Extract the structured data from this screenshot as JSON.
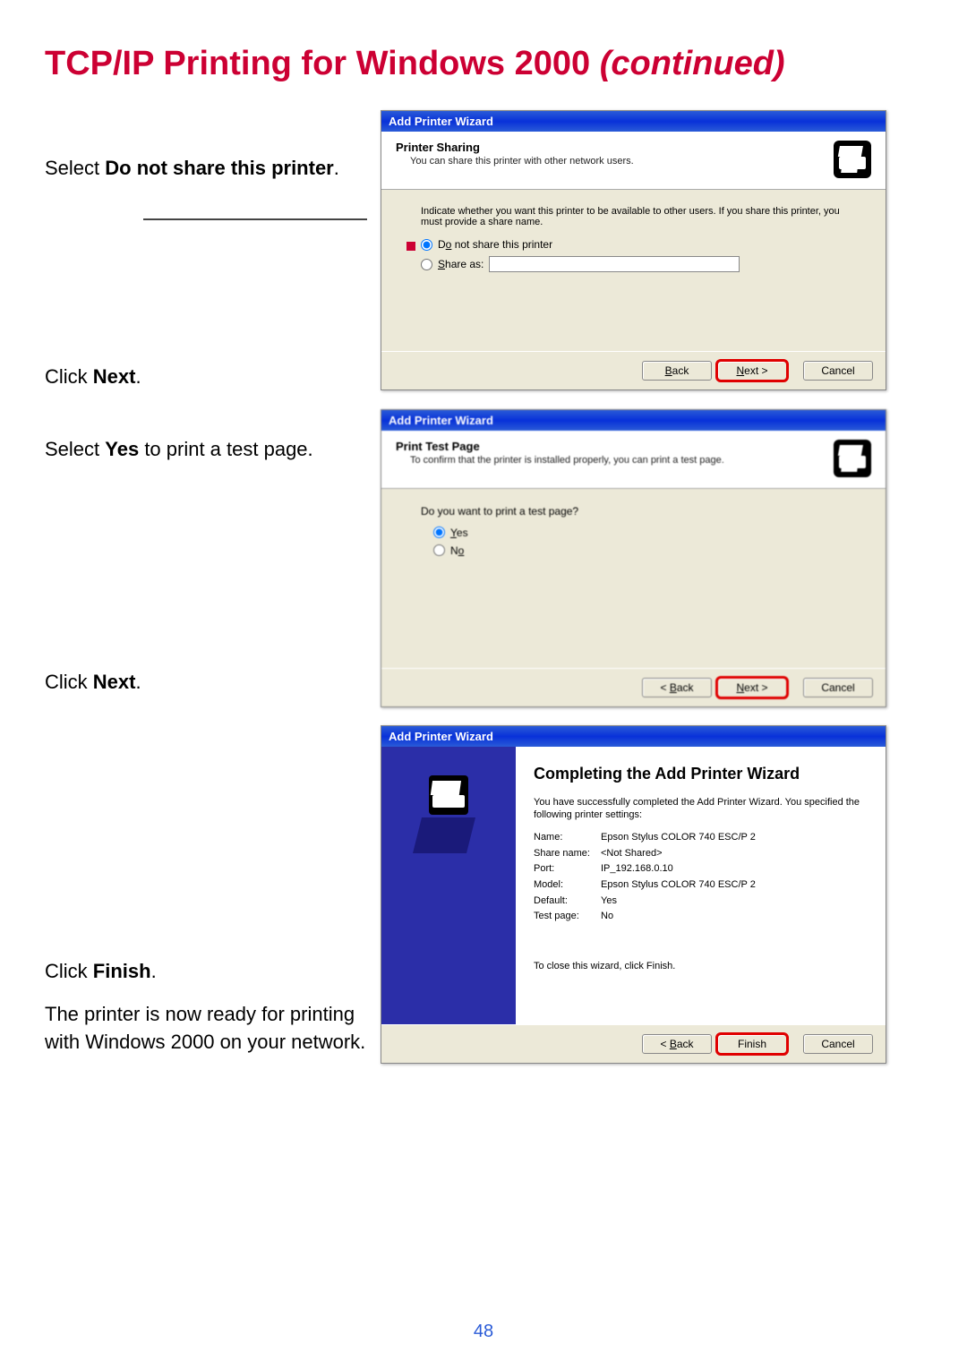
{
  "page": {
    "title_main": "TCP/IP Printing for Windows 2000 ",
    "title_cont": "(continued)",
    "number": "48"
  },
  "instr": {
    "i1_a": "Select ",
    "i1_b": "Do not share this printer",
    "i1_c": ".",
    "i2_a": "Click ",
    "i2_b": "Next",
    "i2_c": ".",
    "i3_a": "Select ",
    "i3_b": "Yes",
    "i3_c": " to print a test page.",
    "i4_a": "Click ",
    "i4_b": "Next",
    "i4_c": ".",
    "i5_a": "Click ",
    "i5_b": "Finish",
    "i5_c": ".",
    "i6": "The printer is now ready for printing with Windows 2000  on your network."
  },
  "wiz1": {
    "title": "Add Printer Wizard",
    "heading": "Printer Sharing",
    "sub": "You can share this printer with other network users.",
    "desc": "Indicate whether you want this printer to be available to other users. If you share this printer, you must provide a share name.",
    "opt1_pre": "D",
    "opt1_ul": "o",
    "opt1_post": " not share this printer",
    "opt2_pre": "",
    "opt2_ul": "S",
    "opt2_post": "hare as:",
    "back": "< Back",
    "next_ul": "N",
    "next_post": "ext >",
    "cancel": "Cancel"
  },
  "wiz2": {
    "title": "Add Printer Wizard",
    "heading": "Print Test Page",
    "sub": "To confirm that the printer is installed properly, you can print a test page.",
    "q": "Do you want to print a test page?",
    "yes_ul": "Y",
    "yes_post": "es",
    "no_pre": "N",
    "no_ul": "o",
    "back": "< Back",
    "next_ul": "N",
    "next_post": "ext >",
    "cancel": "Cancel"
  },
  "wiz3": {
    "title": "Add Printer Wizard",
    "heading": "Completing the Add Printer Wizard",
    "desc": "You have successfully completed the Add Printer Wizard. You specified the following printer settings:",
    "rows": {
      "name_l": "Name:",
      "name_v": "Epson Stylus COLOR 740 ESC/P 2",
      "share_l": "Share name:",
      "share_v": "<Not Shared>",
      "port_l": "Port:",
      "port_v": "IP_192.168.0.10",
      "model_l": "Model:",
      "model_v": "Epson Stylus COLOR 740 ESC/P 2",
      "default_l": "Default:",
      "default_v": "Yes",
      "test_l": "Test page:",
      "test_v": "No"
    },
    "close": "To close this wizard, click Finish.",
    "back": "< Back",
    "finish": "Finish",
    "cancel": "Cancel"
  }
}
